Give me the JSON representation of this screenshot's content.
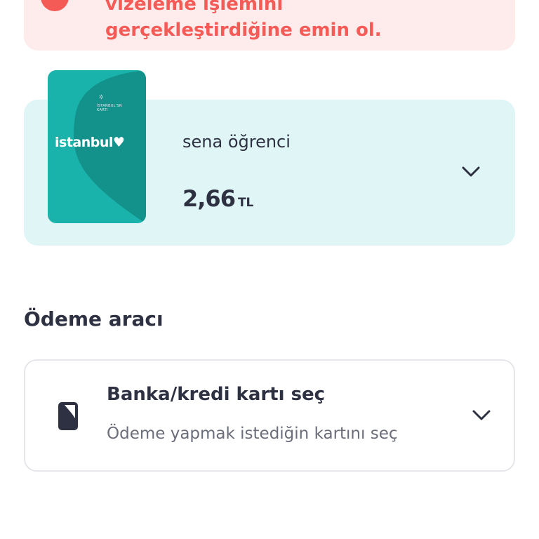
{
  "warning": {
    "lines": [
      "vizeleme işlemini",
      "gerçekleştirdiğine emin ol."
    ]
  },
  "card": {
    "logo_text": "istanbul",
    "small_text": [
      "İSTANBUL'SN",
      "KARTI"
    ],
    "name": "sena öğrenci",
    "amount": "2,66",
    "currency": "TL"
  },
  "payment_section": {
    "title": "Ödeme aracı",
    "selector_title": "Banka/kredi kartı seç",
    "selector_subtitle": "Ödeme yapmak istediğin kartını seç"
  },
  "colors": {
    "warning_text": "#f45b57",
    "warning_bg": "#fdeceb",
    "card_panel_bg": "#e0f5f5",
    "card_teal": "#1ab3ac",
    "card_teal_dark": "#13928c",
    "text_primary": "#2d3142"
  },
  "icons": {
    "warning": "alert-circle-icon",
    "card_chevron": "chevron-down-icon",
    "payment_card": "card-icon",
    "payment_chevron": "chevron-down-icon"
  }
}
